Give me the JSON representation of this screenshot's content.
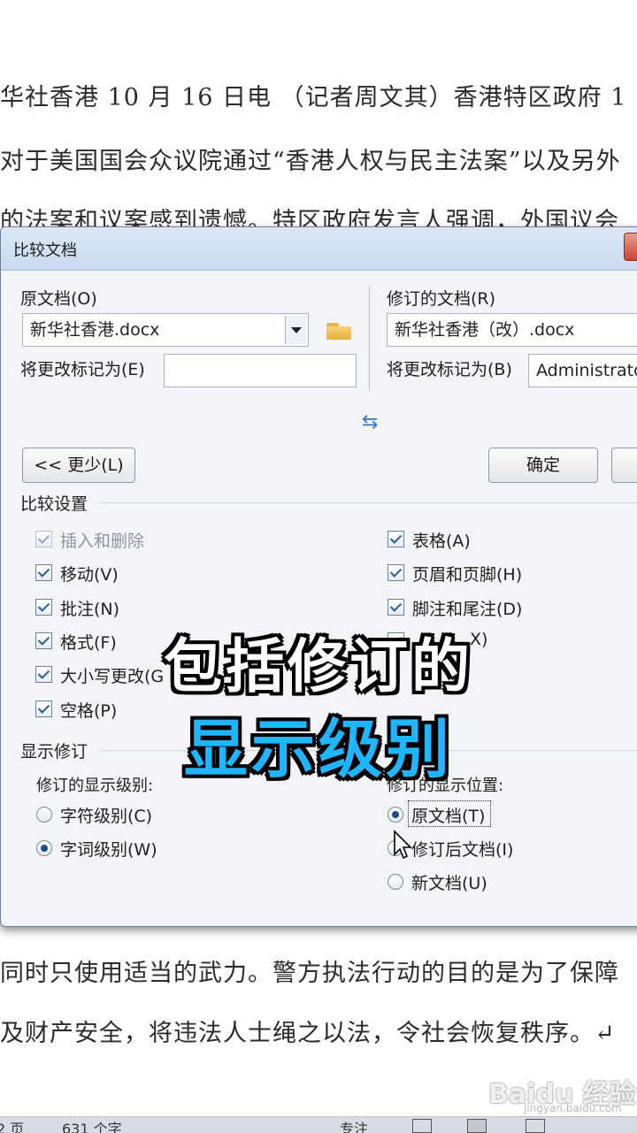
{
  "document": {
    "lines_top": [
      "华社香港 10 月 16 日电 （记者周文其）香港特区政府 1",
      "对于美国国会众议院通过“香港人权与民主法案”以及另外",
      "的法案和议案感到遗憾。特区政府发言人强调，外国议会"
    ],
    "lines_bottom": [
      "同时只使用适当的武力。警方执法行动的目的是为了保障",
      "及财产安全，将违法人士绳之以法，令社会恢复秩序。↵"
    ]
  },
  "dialog": {
    "title": "比较文档",
    "original": {
      "label": "原文档(O)",
      "file": "新华社香港.docx",
      "mark_label": "将更改标记为(E)",
      "mark_value": ""
    },
    "revised": {
      "label": "修订的文档(R)",
      "file": "新华社香港（改）.docx",
      "mark_label": "将更改标记为(B)",
      "mark_value": "Administrator"
    },
    "less_button": "<< 更少(L)",
    "ok_button": "确定",
    "compare_settings": {
      "title": "比较设置",
      "left": [
        {
          "label": "插入和删除",
          "checked": true,
          "disabled": true
        },
        {
          "label": "移动(V)",
          "checked": true
        },
        {
          "label": "批注(N)",
          "checked": true
        },
        {
          "label": "格式(F)",
          "checked": true
        },
        {
          "label": "大小写更改(G",
          "checked": true
        },
        {
          "label": "空格(P)",
          "checked": true
        }
      ],
      "right": [
        {
          "label": "表格(A)",
          "checked": true
        },
        {
          "label": "页眉和页脚(H)",
          "checked": true
        },
        {
          "label": "脚注和尾注(D)",
          "checked": true
        },
        {
          "label": "X)",
          "checked": true
        }
      ]
    },
    "show_changes": {
      "title": "显示修订",
      "level_label": "修订的显示级别:",
      "level_options": [
        {
          "label": "字符级别(C)",
          "checked": false
        },
        {
          "label": "字词级别(W)",
          "checked": true
        }
      ],
      "position_label": "修订的显示位置:",
      "position_options": [
        {
          "label": "原文档(T)",
          "checked": true
        },
        {
          "label": "修订后文档(I)",
          "checked": false
        },
        {
          "label": "新文档(U)",
          "checked": false
        }
      ]
    }
  },
  "overlay": {
    "line1": "包括修订的",
    "line2": "显示级别",
    "line1_color": "#ffffff",
    "line2_color": "#1fb6ff"
  },
  "statusbar": {
    "page": "2 页",
    "words": "631 个字",
    "focus": "专注"
  },
  "watermark": {
    "text": "Baidu 经验",
    "sub": "jingyan.baidu.com"
  }
}
